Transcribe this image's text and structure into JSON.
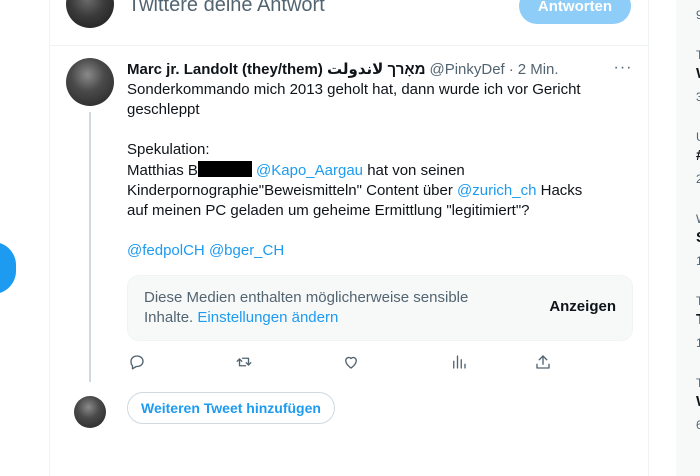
{
  "reply": {
    "placeholder": "Twittere deine Antwort",
    "button_label": "Antworten"
  },
  "tweet": {
    "author_name": "Marc jr. Landolt (they/them) מאָרך لاندولت",
    "handle": "@PinkyDef",
    "separator": "·",
    "time": "2 Min.",
    "line1": "Sonderkommando mich 2013 geholt hat, dann wurde ich vor Gericht geschleppt",
    "line2": "Spekulation:",
    "line3_prefix": "Matthias B",
    "mention_kapo": "@Kapo_Aargau",
    "line3_suffix": " hat von seinen",
    "line4_prefix": "Kinderpornographie\"Beweismitteln\" Content über ",
    "mention_zurich": "@zurich_ch",
    "line4_suffix": " Hacks auf meinen PC geladen um geheime Ermittlung \"legitimiert\"?",
    "mention_fedpol": "@fedpolCH",
    "mention_bger": "@bger_CH"
  },
  "sensitive": {
    "text": "Diese Medien enthalten möglicherweise sensible Inhalte.",
    "link": "Einstellungen ändern",
    "show_label": "Anzeigen"
  },
  "actions": [
    {
      "icon": "reply-icon"
    },
    {
      "icon": "retweet-icon"
    },
    {
      "icon": "like-icon"
    },
    {
      "icon": "views-icon"
    },
    {
      "icon": "share-icon"
    }
  ],
  "add_tweet": {
    "label": "Weiteren Tweet hinzufügen"
  },
  "sidebar_trends": {
    "t1": "9",
    "t2": "T",
    "t3": "W",
    "t4": "3",
    "t5": "U",
    "t6": "#",
    "t7": "2",
    "t8": "W",
    "t9": "S",
    "t10": "1",
    "t11": "T",
    "t12": "T",
    "t13": "1",
    "t14": "T",
    "t15": "W",
    "t16": "6"
  },
  "colors": {
    "accent": "#1d9bf0",
    "muted": "#536471",
    "button_disabled": "#8ecdf8"
  }
}
